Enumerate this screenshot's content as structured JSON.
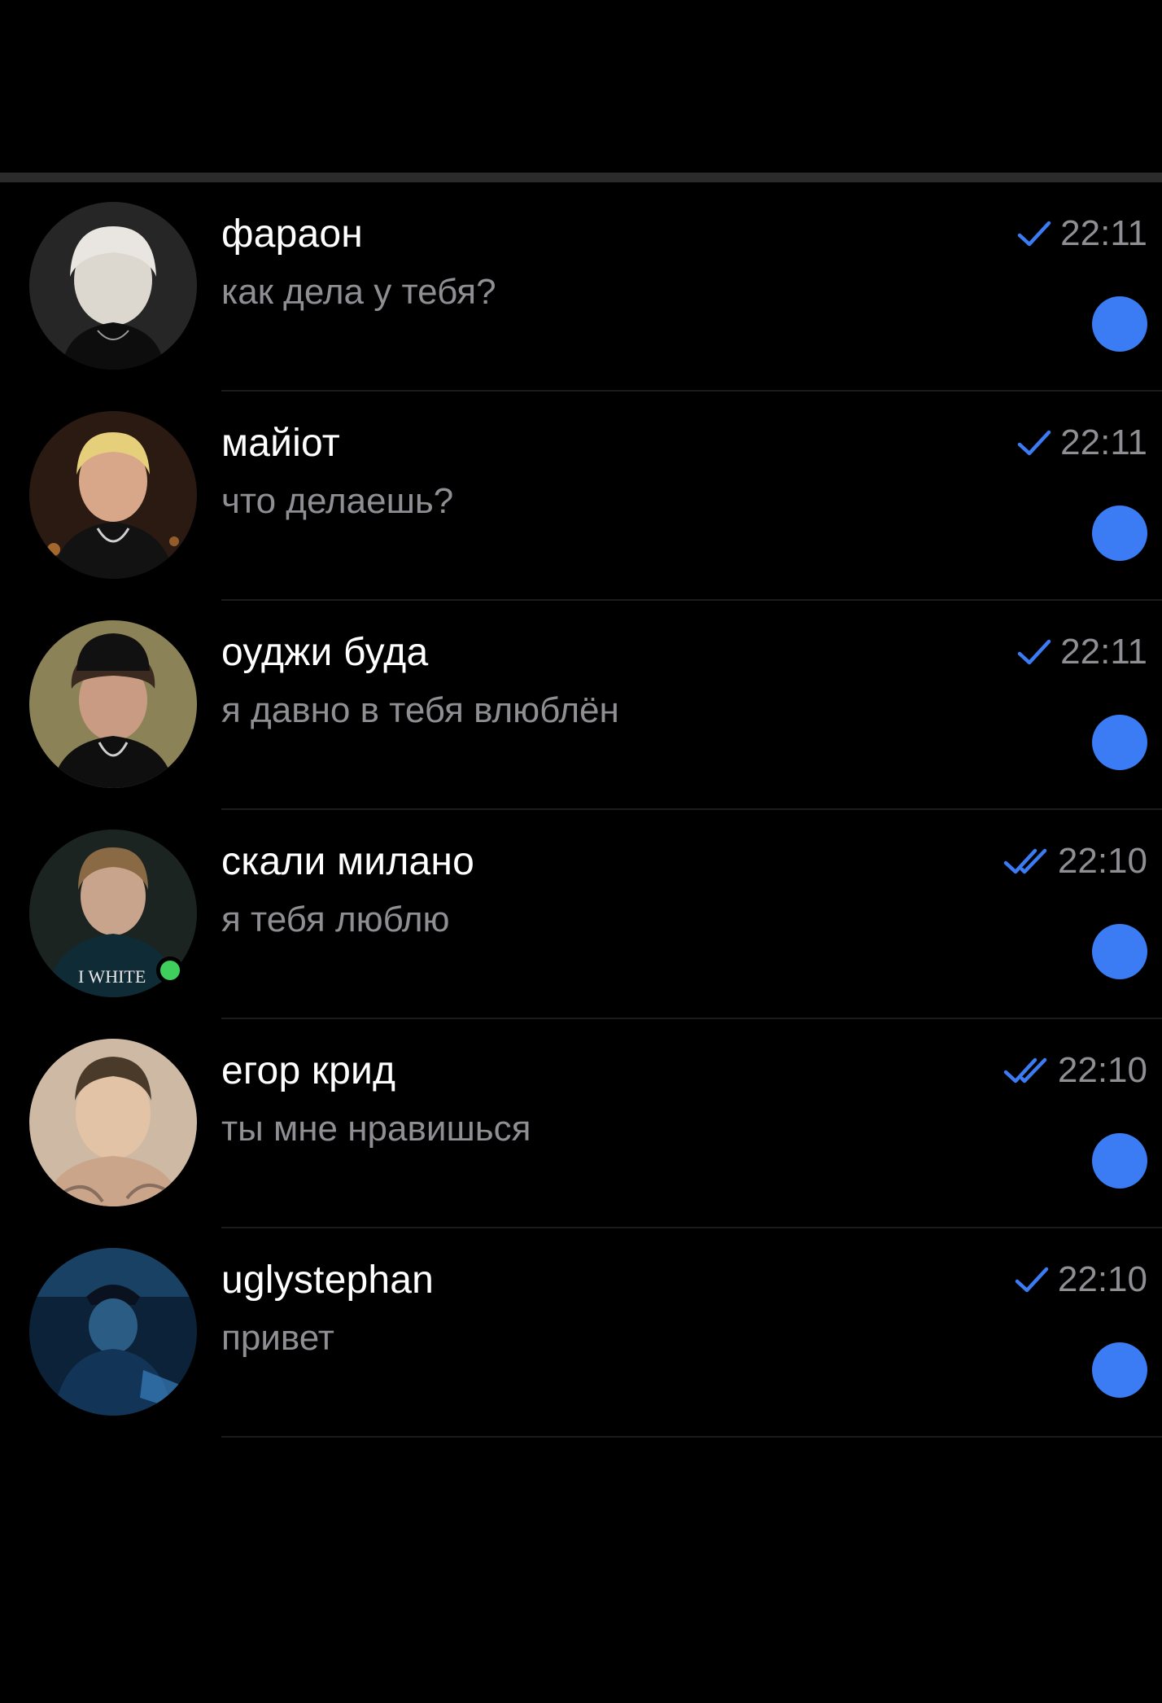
{
  "colors": {
    "background": "#000000",
    "name": "#ffffff",
    "preview": "#8e8e93",
    "accent": "#3b7cf4",
    "online": "#3ecf5c",
    "divider": "#1c1c1e"
  },
  "chats": [
    {
      "name": "фараон",
      "preview": "как дела у тебя?",
      "time": "22:11",
      "status_icon": "single-check-icon",
      "unread": true,
      "online": false
    },
    {
      "name": "майіот",
      "preview": "что делаешь?",
      "time": "22:11",
      "status_icon": "single-check-icon",
      "unread": true,
      "online": false
    },
    {
      "name": "оуджи буда",
      "preview": "я давно в тебя влюблён",
      "time": "22:11",
      "status_icon": "single-check-icon",
      "unread": true,
      "online": false
    },
    {
      "name": "скали милано",
      "preview": "я тебя люблю",
      "time": "22:10",
      "status_icon": "double-check-icon",
      "unread": true,
      "online": true,
      "avatar_shirt_text": "I WHITE"
    },
    {
      "name": "егор крид",
      "preview": "ты мне нравишься",
      "time": "22:10",
      "status_icon": "double-check-icon",
      "unread": true,
      "online": false
    },
    {
      "name": "uglystephan",
      "preview": "привет",
      "time": "22:10",
      "status_icon": "single-check-icon",
      "unread": true,
      "online": false
    }
  ]
}
